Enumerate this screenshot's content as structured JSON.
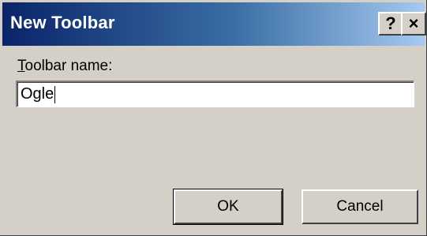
{
  "window": {
    "title": "New Toolbar",
    "help_glyph": "?",
    "close_glyph": "×"
  },
  "form": {
    "label_accel": "T",
    "label_rest": "oolbar name:",
    "value": "Ogle"
  },
  "buttons": {
    "ok_label": "OK",
    "cancel_label": "Cancel"
  },
  "colors": {
    "title_active_start": "#0a246a",
    "title_active_end": "#a6caf0",
    "face": "#d4d0c8"
  }
}
